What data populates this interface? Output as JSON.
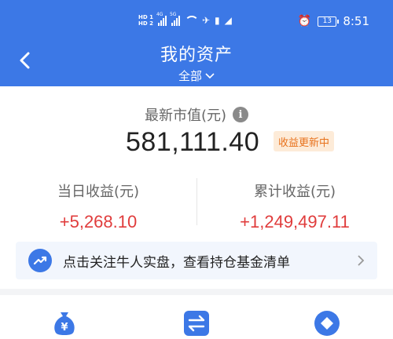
{
  "status_bar": {
    "hd_top": "HD 1",
    "hd_bottom": "HD 2",
    "net1": "4G",
    "net2": "5G",
    "battery": "13",
    "time": "8:51"
  },
  "header": {
    "title": "我的资产",
    "scope": "全部",
    "colors": {
      "primary": "#3C78E6"
    }
  },
  "market_value": {
    "label": "最新市值(元)",
    "value": "581,111.40",
    "badge": "收益更新中"
  },
  "daily_profit": {
    "label": "当日收益(元)",
    "value": "+5,268.10"
  },
  "total_profit": {
    "label": "累计收益(元)",
    "value": "+1,249,497.11"
  },
  "promo": {
    "text": "点击关注牛人实盘，查看持仓基金清单"
  },
  "icons": {
    "back": "chevron-left-icon",
    "scope": "chevron-down-icon",
    "info": "info-icon",
    "trend": "trend-up-icon",
    "promo_arrow": "chevron-right-icon",
    "nav": [
      "money-bag-icon",
      "transfer-icon",
      "diamond-circle-icon"
    ]
  }
}
